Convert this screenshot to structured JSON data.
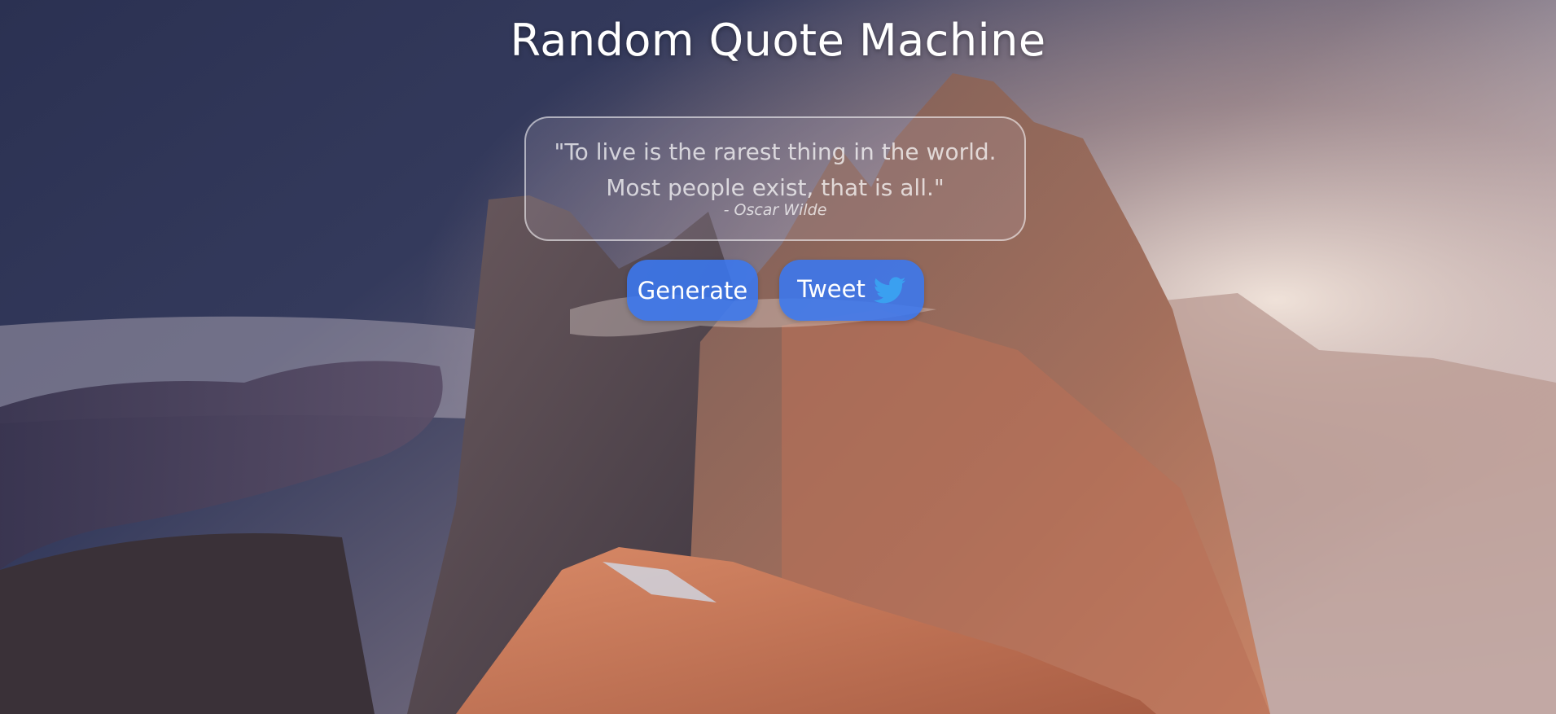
{
  "page": {
    "title": "Random Quote Machine"
  },
  "quote": {
    "text": "\"To live is the rarest thing in the world. Most people exist, that is all.\"",
    "author": "- Oscar Wilde"
  },
  "buttons": {
    "generate_label": "Generate",
    "tweet_label": "Tweet",
    "tweet_icon": "twitter-bird-icon"
  },
  "colors": {
    "button_accent": "#3a78f0",
    "twitter_blue": "#3aa0f0",
    "title_text": "#ffffff"
  },
  "background": {
    "image_subject": "mountain-peaks-at-sunrise"
  }
}
